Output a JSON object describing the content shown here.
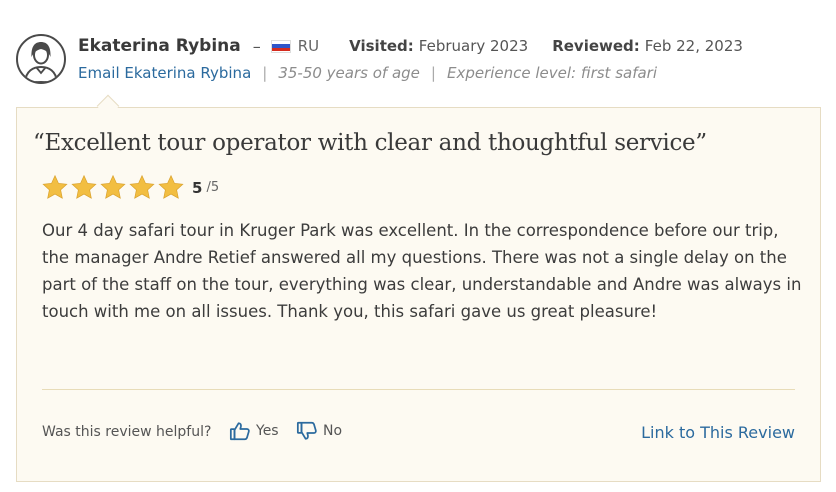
{
  "reviewer": {
    "name": "Ekaterina Rybina",
    "separator": "–",
    "country_code": "RU",
    "avatar_icon": "user-avatar-icon",
    "flag_icon": "russia-flag-icon",
    "email_link": "Email Ekaterina Rybina",
    "age_range": "35-50 years of age",
    "experience": "Experience level: first safari"
  },
  "visit": {
    "visited_label": "Visited:",
    "visited_value": "February 2023",
    "reviewed_label": "Reviewed:",
    "reviewed_value": "Feb 22, 2023"
  },
  "review": {
    "title": "“Excellent tour operator with clear and thoughtful service”",
    "rating": 5,
    "rating_value": "5",
    "rating_max": "/5",
    "star_icon": "star-icon",
    "body": "Our 4 day safari tour in Kruger Park was excellent. In the correspondence before our trip, the manager Andre Retief answered all my questions. There was not a single delay on the part of the staff on the tour, everything was clear, understandable and Andre was always in touch with me on all issues. Thank you, this safari gave us great pleasure!"
  },
  "footer": {
    "helpful_question": "Was this review helpful?",
    "yes_label": "Yes",
    "no_label": "No",
    "yes_icon": "thumbs-up-icon",
    "no_icon": "thumbs-down-icon",
    "link_label": "Link to This Review"
  },
  "colors": {
    "link": "#2b6a9e",
    "card_background": "#fdfaf2",
    "card_border": "#e6dcc3",
    "star": "#f2be42"
  }
}
